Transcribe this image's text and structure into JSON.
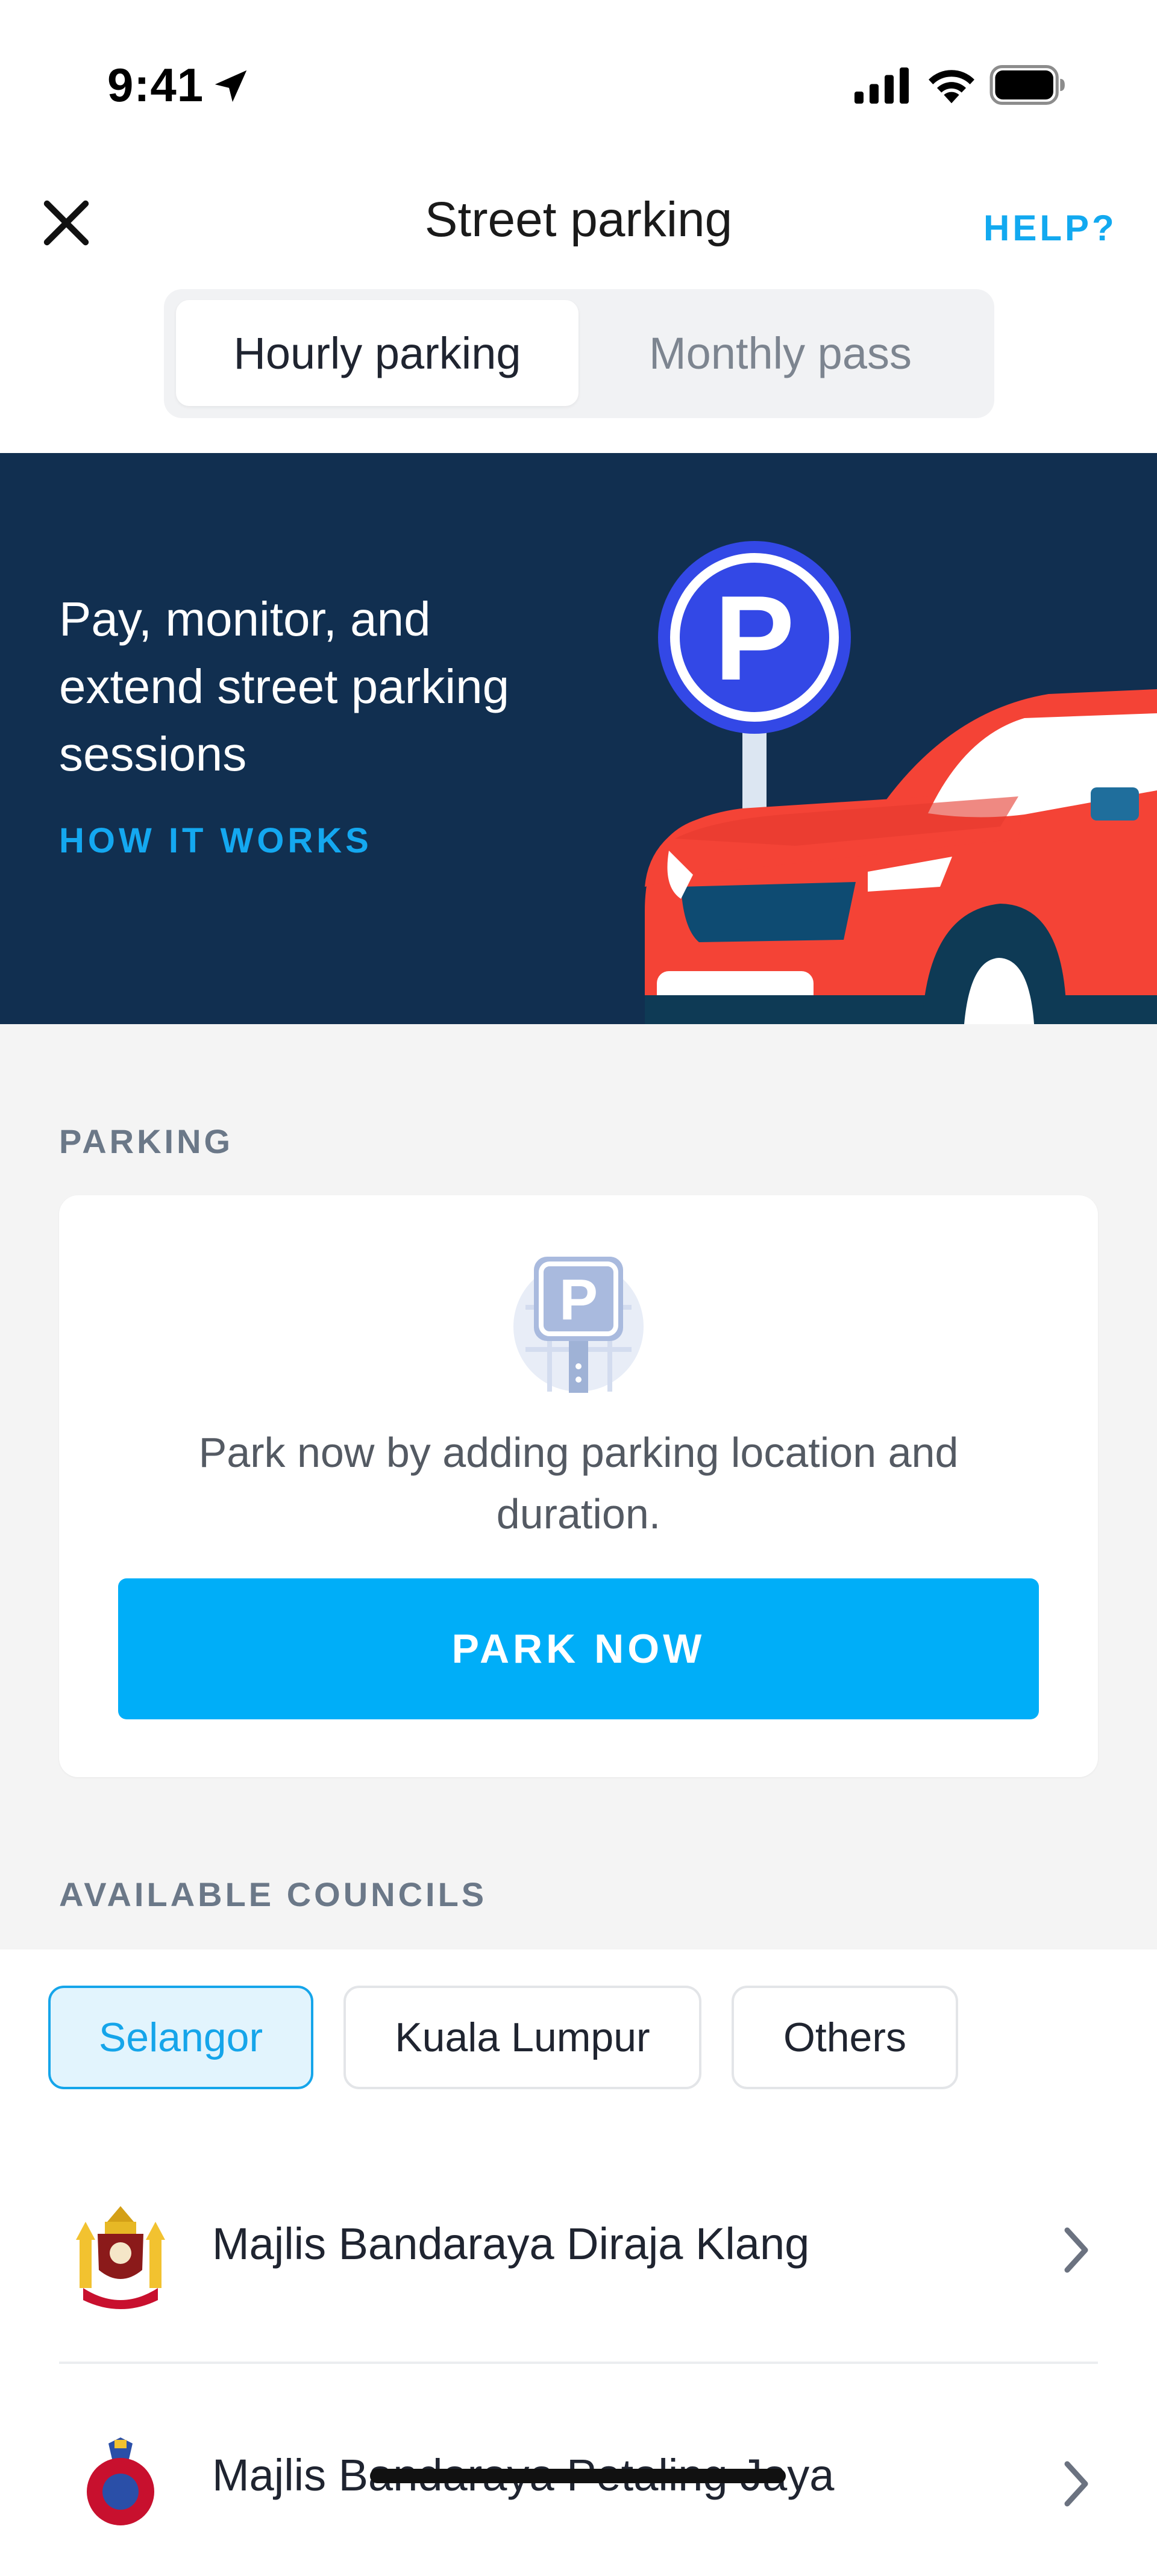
{
  "status_bar": {
    "time": "9:41"
  },
  "header": {
    "title": "Street parking",
    "help_label": "HELP?"
  },
  "tabs": [
    {
      "label": "Hourly parking",
      "selected": true
    },
    {
      "label": "Monthly pass",
      "selected": false
    }
  ],
  "banner": {
    "text": "Pay, monitor, and extend street parking sessions",
    "link_label": "HOW IT WORKS",
    "sign_letter": "P"
  },
  "parking": {
    "heading": "PARKING",
    "card_icon_letter": "P",
    "card_text": "Park now by adding parking location and duration.",
    "button_label": "PARK NOW"
  },
  "councils": {
    "heading": "AVAILABLE COUNCILS",
    "chips": [
      {
        "label": "Selangor",
        "selected": true
      },
      {
        "label": "Kuala Lumpur",
        "selected": false
      },
      {
        "label": "Others",
        "selected": false
      }
    ],
    "items": [
      {
        "name": "Majlis Bandaraya Diraja Klang"
      },
      {
        "name": "Majlis Bandaraya Petaling Jaya"
      }
    ]
  },
  "colors": {
    "accent": "#00aef8",
    "banner_bg": "#112f50",
    "car_red": "#f44336",
    "sign_blue": "#3348e6"
  }
}
